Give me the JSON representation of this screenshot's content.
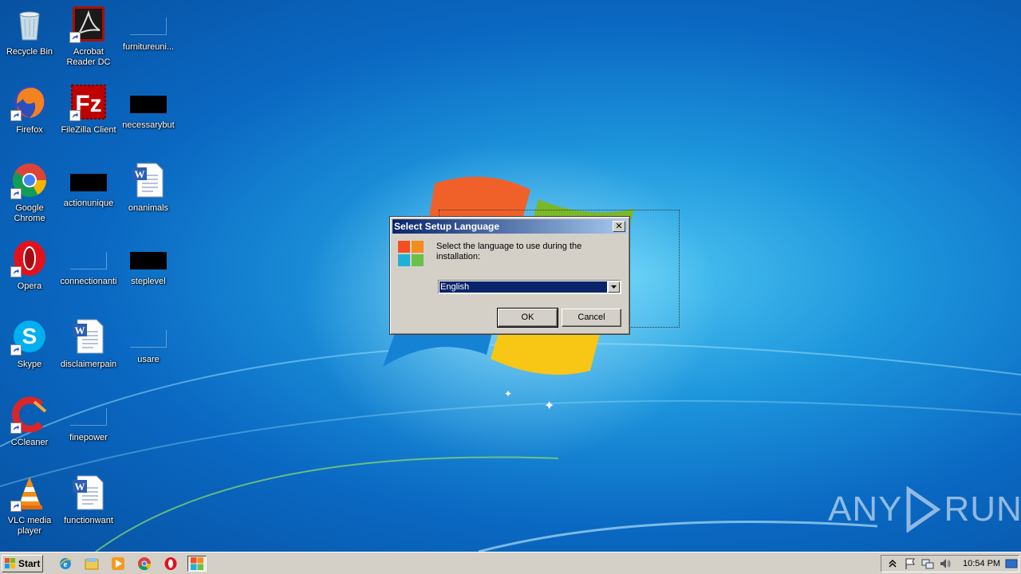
{
  "desktop": {
    "icons": [
      {
        "label": "Recycle Bin",
        "icon": "recycle-bin-icon"
      },
      {
        "label": "Acrobat Reader DC",
        "icon": "acrobat-icon"
      },
      {
        "label": "furnitureuni...",
        "icon": "blank-file-icon"
      },
      {
        "label": "Firefox",
        "icon": "firefox-icon"
      },
      {
        "label": "FileZilla Client",
        "icon": "filezilla-icon"
      },
      {
        "label": "necessarybut",
        "icon": "black-thumbnail-icon"
      },
      {
        "label": "Google Chrome",
        "icon": "chrome-icon"
      },
      {
        "label": "actionunique",
        "icon": "black-thumbnail-icon"
      },
      {
        "label": "onanimals",
        "icon": "word-document-icon"
      },
      {
        "label": "Opera",
        "icon": "opera-icon"
      },
      {
        "label": "connectionanti",
        "icon": "blank-file-icon"
      },
      {
        "label": "steplevel",
        "icon": "black-thumbnail-icon"
      },
      {
        "label": "Skype",
        "icon": "skype-icon"
      },
      {
        "label": "disclaimerpain",
        "icon": "word-document-icon"
      },
      {
        "label": "usare",
        "icon": "blank-file-icon"
      },
      {
        "label": "CCleaner",
        "icon": "ccleaner-icon"
      },
      {
        "label": "finepower",
        "icon": "blank-file-icon"
      },
      {
        "label": "VLC media player",
        "icon": "vlc-icon"
      },
      {
        "label": "functionwant",
        "icon": "word-document-icon"
      }
    ]
  },
  "dialog": {
    "title": "Select Setup Language",
    "close_label": "✕",
    "message": "Select the language to use during the installation:",
    "language_selected": "English",
    "ok_label": "OK",
    "cancel_label": "Cancel"
  },
  "watermark": {
    "left": "ANY",
    "right": "RUN"
  },
  "taskbar": {
    "start_label": "Start",
    "quick_launch": [
      "ie-icon",
      "explorer-icon",
      "media-player-icon",
      "chrome-icon",
      "opera-icon",
      "setup-icon"
    ],
    "tray_icons": [
      "show-hidden-icon",
      "action-center-flag-icon",
      "network-icon",
      "volume-icon"
    ],
    "clock": "10:54 PM"
  },
  "colors": {
    "dialog_face": "#d4d0c8",
    "title_start": "#0a246a",
    "title_end": "#a6caf0",
    "selection": "#0a246a"
  }
}
